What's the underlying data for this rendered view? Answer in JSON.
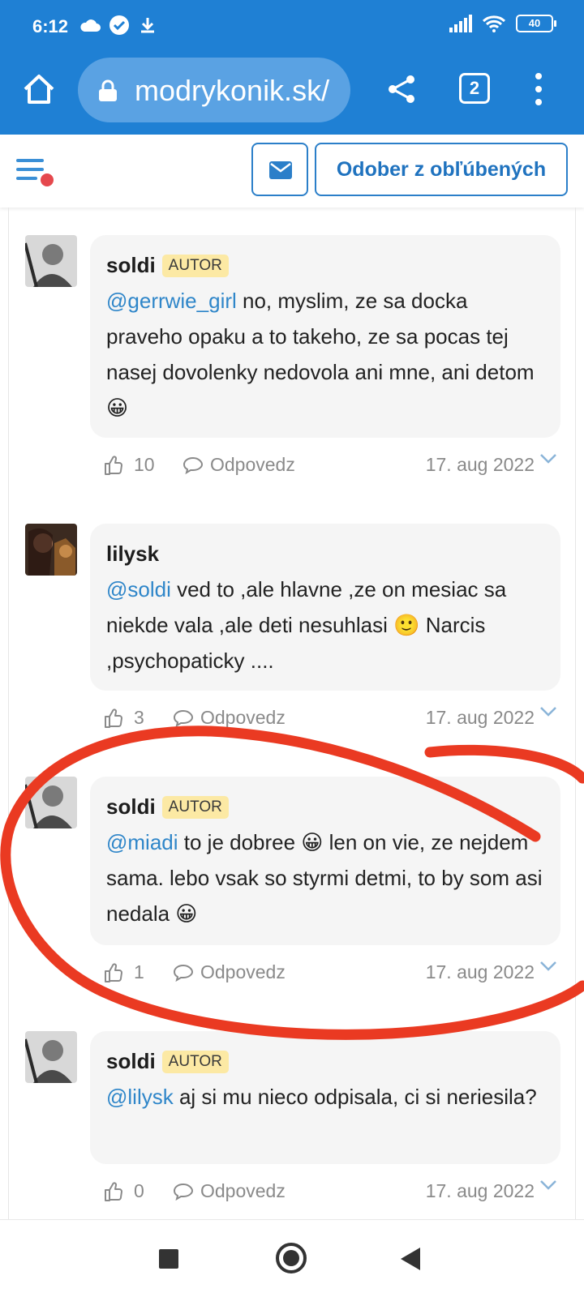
{
  "status_bar": {
    "time": "6:12",
    "icons_left": [
      "cloud-icon",
      "check-badge-icon",
      "download-icon"
    ],
    "icons_right": [
      "signal-icon",
      "wifi-icon"
    ],
    "battery": "40"
  },
  "browser": {
    "url": "modrykonik.sk/",
    "tab_count": "2",
    "accent_color": "#1f80d4"
  },
  "site_header": {
    "favorite_button": "Odober z obľúbených"
  },
  "comments": [
    {
      "author": "soldi",
      "badge": "AUTOR",
      "mention": "@gerrwie_girl",
      "text": " no, myslim, ze sa docka praveho opaku a to takeho, ze sa pocas tej nasej dovolenky nedovola ani mne, ani detom 😀",
      "likes": "10",
      "reply_label": "Odpovedz",
      "date": "17. aug 2022"
    },
    {
      "author": "lilysk",
      "badge": "",
      "mention": "@soldi",
      "text": " ved to ,ale hlavne ,ze on mesiac sa niekde vala ,ale deti nesuhlasi 🙂 Narcis ,psychopaticky ....",
      "likes": "3",
      "reply_label": "Odpovedz",
      "date": "17. aug 2022"
    },
    {
      "author": "soldi",
      "badge": "AUTOR",
      "mention": "@miadi",
      "text": " to je dobree 😀 len on vie, ze nejdem sama. lebo vsak so styrmi detmi, to by som asi nedala 😀",
      "likes": "1",
      "reply_label": "Odpovedz",
      "date": "17. aug 2022"
    },
    {
      "author": "soldi",
      "badge": "AUTOR",
      "mention": "@lilysk",
      "text": " aj si mu nieco odpisala, ci si neriesila?",
      "likes": "0",
      "reply_label": "Odpovedz",
      "date": "17. aug 2022"
    }
  ]
}
